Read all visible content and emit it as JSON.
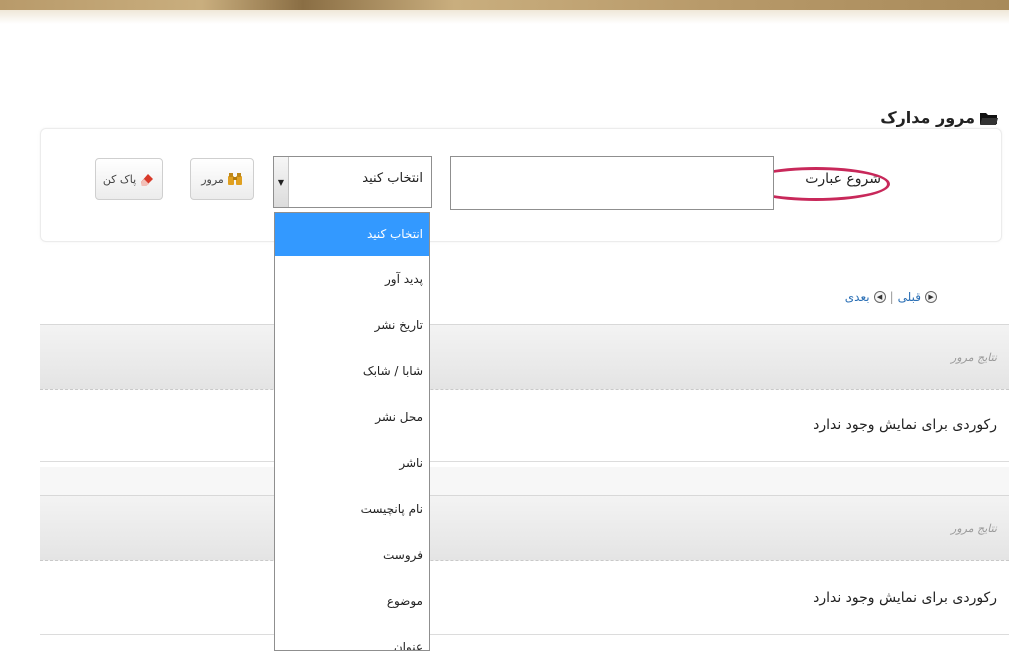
{
  "page": {
    "title": "مرور مدارک"
  },
  "search": {
    "criterion_label": "شروع عبارت",
    "input_value": "",
    "field_select": {
      "selected": "انتخاب کنید",
      "options": [
        "انتخاب کنید",
        "پدید آور",
        "تاریخ نشر",
        "شابا / شابک",
        "محل نشر",
        "ناشر",
        "نام پانچیست",
        "فروست",
        "موضوع",
        "عنوان"
      ]
    },
    "browse_label": "مرور",
    "clear_label": "پاک کن"
  },
  "pager": {
    "previous": "قبلی",
    "separator": "|",
    "next": "بعدی"
  },
  "results": [
    {
      "header": "نتایج مرور",
      "message": "رکوردی برای نمایش وجود ندارد"
    },
    {
      "header": "نتایج مرور",
      "message": "رکوردی برای نمایش وجود ندارد"
    }
  ],
  "colors": {
    "highlight": "#c8285a",
    "selected_option": "#3399ff",
    "link": "#2a6fb5"
  },
  "icons": {
    "title": "folder-icon",
    "browse": "binoculars-icon",
    "clear": "eraser-icon",
    "previous": "arrow-right-circle-icon",
    "next": "arrow-left-circle-icon"
  }
}
